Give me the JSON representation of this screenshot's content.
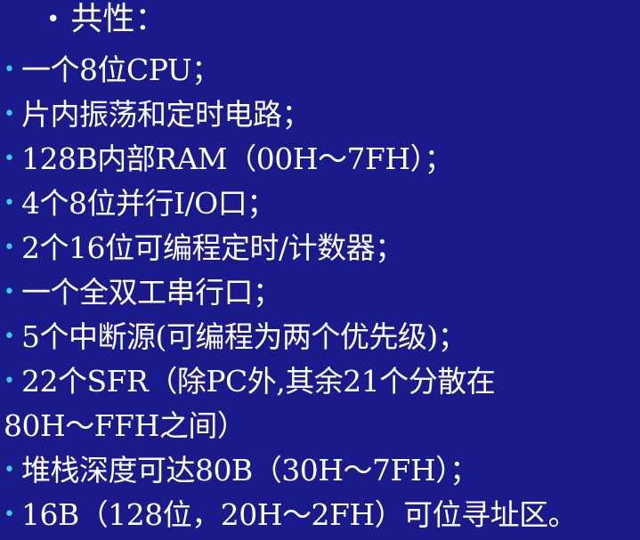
{
  "slide": {
    "heading": {
      "bullet": "•",
      "text": "共性："
    },
    "items": [
      {
        "bullet": "•",
        "text": "一个8位CPU；"
      },
      {
        "bullet": "•",
        "text": "片内振荡和定时电路；"
      },
      {
        "bullet": "•",
        "text": "128B内部RAM（00H～7FH）；"
      },
      {
        "bullet": "•",
        "text": "4个8位并行I/O口；"
      },
      {
        "bullet": "•",
        "text": "2个16位可编程定时/计数器；"
      },
      {
        "bullet": "•",
        "text": "一个全双工串行口；"
      },
      {
        "bullet": "•",
        "text": "5个中断源(可编程为两个优先级)；"
      },
      {
        "bullet": "•",
        "text": "22个SFR（除PC外,其余21个分散在"
      },
      {
        "bullet": "",
        "text": "80H～FFH之间）"
      },
      {
        "bullet": "•",
        "text": "堆栈深度可达80B（30H～7FH）；"
      },
      {
        "bullet": "•",
        "text": "16B（128位，20H～2FH）可位寻址区。"
      }
    ]
  },
  "colors": {
    "background": "#1a1a8a",
    "text": "#ffffff",
    "bullet": "#3fd0e8"
  }
}
